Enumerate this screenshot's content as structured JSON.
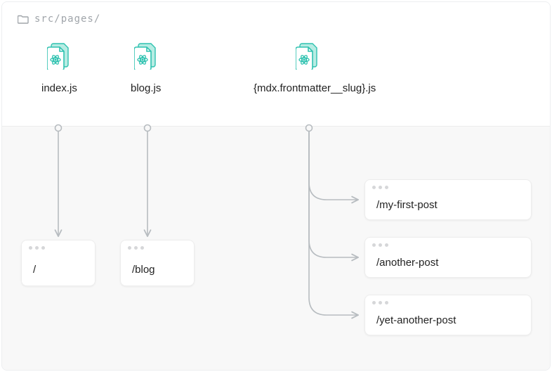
{
  "breadcrumb": {
    "path": "src/pages/"
  },
  "files": {
    "index": {
      "name": "index.js"
    },
    "blog": {
      "name": "blog.js"
    },
    "slug": {
      "name": "{mdx.frontmatter__slug}.js"
    }
  },
  "pages": {
    "root": {
      "path": "/"
    },
    "blog": {
      "path": "/blog"
    },
    "post1": {
      "path": "/my-first-post"
    },
    "post2": {
      "path": "/another-post"
    },
    "post3": {
      "path": "/yet-another-post"
    }
  },
  "icons": {
    "folder": "folder-icon",
    "react_file": "react-file-icon"
  },
  "colors": {
    "teal": "#2fc2b0",
    "teal_light": "#9fe6dc",
    "gray_line": "#b7bcc0",
    "gray_text": "#a0a5aa"
  }
}
